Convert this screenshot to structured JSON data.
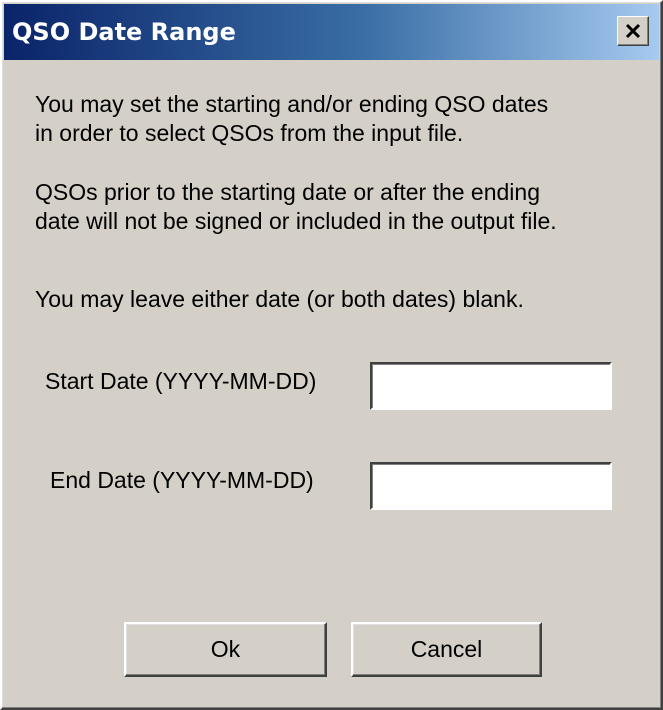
{
  "window": {
    "title": "QSO Date Range",
    "close_icon": "close-icon"
  },
  "body": {
    "paragraph1": "You may set the starting and/or ending QSO dates\nin order to select QSOs from the input file.",
    "paragraph2": "QSOs prior to the starting date or after the ending\ndate will not be signed or included in the output file.",
    "paragraph3": "You may leave either date (or both dates) blank."
  },
  "fields": {
    "start_label": "Start Date (YYYY-MM-DD)",
    "start_value": "",
    "end_label": "End Date (YYYY-MM-DD)",
    "end_value": ""
  },
  "buttons": {
    "ok_label": "Ok",
    "cancel_label": "Cancel"
  },
  "colors": {
    "titlebar_start": "#0a246a",
    "titlebar_end": "#a6caf0",
    "face": "#d4d0c8"
  }
}
